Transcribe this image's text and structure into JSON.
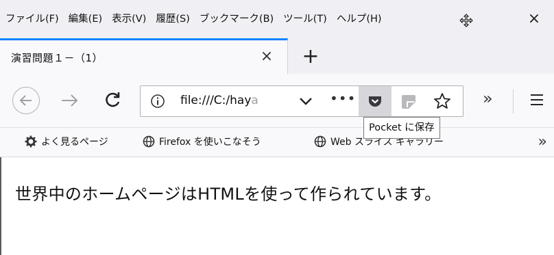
{
  "menubar": {
    "items": [
      "ファイル(F)",
      "編集(E)",
      "表示(V)",
      "履歴(S)",
      "ブックマーク(B)",
      "ツール(T)",
      "ヘルプ(H)"
    ],
    "close_glyph": "×"
  },
  "tab": {
    "title": "演習問題１－（1）",
    "close_glyph": "×",
    "new_tab_glyph": "+"
  },
  "urlbar": {
    "url_visible": "file:///C:/hay",
    "url_faded": "a",
    "more_glyph": "•••"
  },
  "toolbar": {
    "overflow_glyph": "»"
  },
  "tooltip": {
    "text": "Pocket に保存"
  },
  "bookmarks": {
    "items": [
      "よく見るページ",
      "Firefox を使いこなそう",
      "Web スライス ギャラリー"
    ],
    "overflow_glyph": "»"
  },
  "page": {
    "body_text": "世界中のホームページはHTMLを使って作られています。"
  },
  "colors": {
    "tab_accent": "#0a84ff",
    "chrome_bg": "#f0f0f4",
    "toolbar_bg": "#f9f9fb",
    "pocket_active_bg": "#d7d7db"
  },
  "icons": [
    "back-arrow-icon",
    "forward-arrow-icon",
    "reload-icon",
    "info-icon",
    "chevron-down-icon",
    "pocket-icon",
    "page-action-icon",
    "star-icon",
    "hamburger-icon",
    "gear-icon",
    "globe-icon",
    "move-cursor-icon"
  ]
}
